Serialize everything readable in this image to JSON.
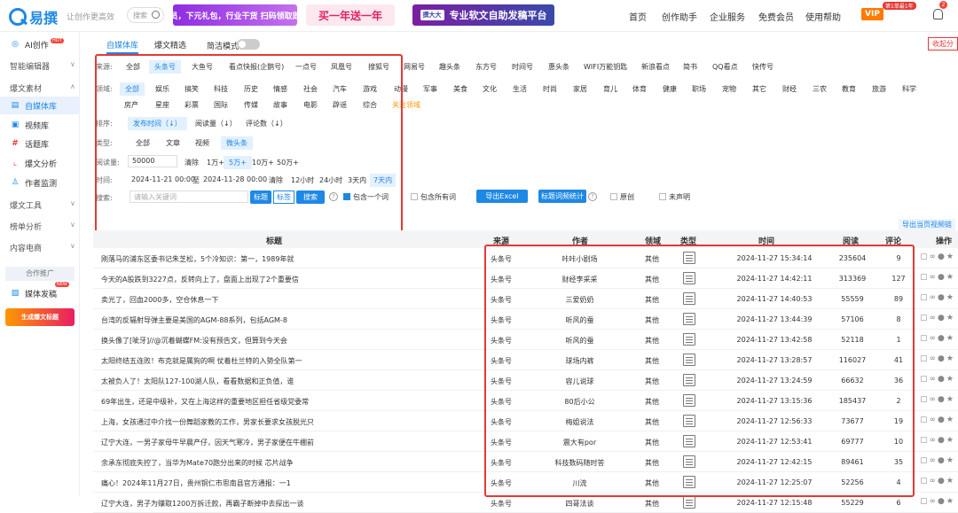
{
  "header": {
    "logo_text": "易撰",
    "slogan": "让创作更高效",
    "search_placeholder": "搜索",
    "banner1": "免费会员，下元礼包，行业干货 扫码领取即可领取",
    "banner2": "买一年送一年",
    "banner3_tag": "撰大大",
    "banner3": "专业软文自助发稿平台",
    "nav": [
      "首页",
      "创作助手",
      "企业服务",
      "免费会员",
      "使用帮助"
    ],
    "vip": "VIP",
    "vip_badge": "第1单最1年",
    "notify_count": "2"
  },
  "sidebar": {
    "ai": "AI创作",
    "ai_badge": "HOT",
    "sections": [
      "智能编辑器",
      "爆文素材"
    ],
    "items": [
      "自媒体库",
      "视频库",
      "话题库",
      "爆文分析",
      "作者监测"
    ],
    "sections2": [
      "爆文工具",
      "榜单分析",
      "内容电商"
    ],
    "promo": "合作推广",
    "media": "媒体发稿",
    "media_badge": "NEW",
    "ad": "生成爆文标题"
  },
  "main": {
    "tabs": [
      "自媒体库",
      "爆文精选"
    ],
    "simple_mode": "简洁模式",
    "collect": "收起分",
    "filters": {
      "source_label": "来源:",
      "sources": [
        "全部",
        "头条号",
        "大鱼号",
        "看点快报(企鹅号)",
        "一点号",
        "凤凰号",
        "搜狐号",
        "网易号",
        "趣头条",
        "东方号",
        "时间号",
        "惠头条",
        "WIFI万能钥匙",
        "新浪看点",
        "简书",
        "QQ看点",
        "快传号"
      ],
      "domain_label": "领域:",
      "domains1": [
        "全部",
        "娱乐",
        "搞笑",
        "科技",
        "历史",
        "情感",
        "社会",
        "汽车",
        "游戏",
        "动漫",
        "军事",
        "美食",
        "文化",
        "生活",
        "时尚",
        "家居",
        "育儿",
        "体育",
        "健康",
        "职场",
        "宠物",
        "其它",
        "财经",
        "三农",
        "教育",
        "旅游",
        "科学"
      ],
      "domains2": [
        "房产",
        "星座",
        "彩票",
        "国际",
        "传媒",
        "故事",
        "电影",
        "辟谣",
        "综合"
      ],
      "domain_more": "关注领域",
      "sort_label": "排序:",
      "sorts": [
        "发布时间（↓）",
        "阅读量（↓）",
        "评论数（↓）"
      ],
      "type_label": "类型:",
      "types": [
        "全部",
        "文章",
        "视频",
        "微头条"
      ],
      "read_label": "阅读量:",
      "read_value": "50000",
      "read_opts": [
        "清除",
        "1万+",
        "5万+",
        "10万+",
        "50万+"
      ],
      "time_label": "时间:",
      "time_start": "2024-11-21 00:00",
      "time_sep": "至",
      "time_end": "2024-11-28 00:00",
      "time_opts": [
        "清除",
        "12小时",
        "24小时",
        "3天内",
        "7天内"
      ],
      "search_label": "搜索:",
      "search_placeholder": "请输入关键词",
      "search_in": [
        "标题",
        "标签"
      ],
      "search_btn": "搜索",
      "checks": [
        "包含一个词",
        "包含所有词"
      ],
      "export_excel": "导出Excel",
      "title_stats": "标题词频统计",
      "checks2": [
        "原创",
        "未声明"
      ]
    },
    "export_current": "导出当页视频链",
    "table": {
      "headers": [
        "标题",
        "来源",
        "作者",
        "领域",
        "类型",
        "时间",
        "阅读",
        "评论",
        "操作"
      ],
      "rows": [
        [
          "刚落马的浦东区委书记朱芝松，5个冷知识：第一，1989年就",
          "头条号",
          "咔咔小剧场",
          "其他",
          "2024-11-27 15:34:14",
          "235604",
          "9"
        ],
        [
          "今天的A股跌到3227点，反转向上了，盘面上出现了2个重要信",
          "头条号",
          "财经李采采",
          "其他",
          "2024-11-27 14:42:11",
          "313369",
          "127"
        ],
        [
          "卖光了，回血2000多，空仓休息一下",
          "头条号",
          "三爱奶奶",
          "其他",
          "2024-11-27 14:40:53",
          "55559",
          "89"
        ],
        [
          "台湾的反辐射导弹主要是美国的AGM-88系列，包括AGM-8",
          "头条号",
          "听风的蚕",
          "其他",
          "2024-11-27 13:44:39",
          "57106",
          "8"
        ],
        [
          "换头像了[呲牙]//@沉着蝴蝶FM:没有预告文，但算到今天会",
          "头条号",
          "听风的蚕",
          "其他",
          "2024-11-27 13:42:58",
          "52118",
          "1"
        ],
        [
          "太阳终结五连败！布克就是属狗的啊 仗着杜兰特的入勢全队第一",
          "头条号",
          "球场内裤",
          "其他",
          "2024-11-27 13:28:57",
          "116027",
          "41"
        ],
        [
          "太被负人了！太阳队127-100湖人队，看看数据和正负值，谁",
          "头条号",
          "容儿说球",
          "其他",
          "2024-11-27 13:24:59",
          "66632",
          "36"
        ],
        [
          "69年出生，还是中级补，又在上海这样的重要地区担任省级党委常",
          "头条号",
          "80后小公",
          "其他",
          "2024-11-27 13:15:36",
          "185437",
          "2"
        ],
        [
          "上海，女孩通过中介找一份舞蹈家教的工作，男家长要求女孩脱光只",
          "头条号",
          "梅姐说法",
          "其他",
          "2024-11-27 12:56:33",
          "73677",
          "19"
        ],
        [
          "辽宁大连，一男子家母牛早晨产仔，因天气寒冷，男子家便在牛棚前",
          "头条号",
          "震大有por",
          "其他",
          "2024-11-27 12:53:41",
          "69777",
          "10"
        ],
        [
          "余承东彻底失控了，当华为Mate70跑分出来的时候 芯片战争",
          "头条号",
          "科技数码随时答",
          "其他",
          "2024-11-27 12:42:15",
          "89461",
          "35"
        ],
        [
          "痛心！2024年11月27日，贵州铜仁市思南县官方通报：一1",
          "头条号",
          "川流",
          "其他",
          "2024-11-27 12:25:07",
          "52256",
          "4"
        ],
        [
          "辽宁大连，男子为赚取1200万拆迁款，再霸子断掉中去探出一谈",
          "头条号",
          "四哥法谈",
          "其他",
          "2024-11-27 12:15:48",
          "55229",
          "6"
        ]
      ]
    }
  },
  "colors": {
    "accent": "#1e88e5",
    "highlight_border": "#e53935"
  }
}
